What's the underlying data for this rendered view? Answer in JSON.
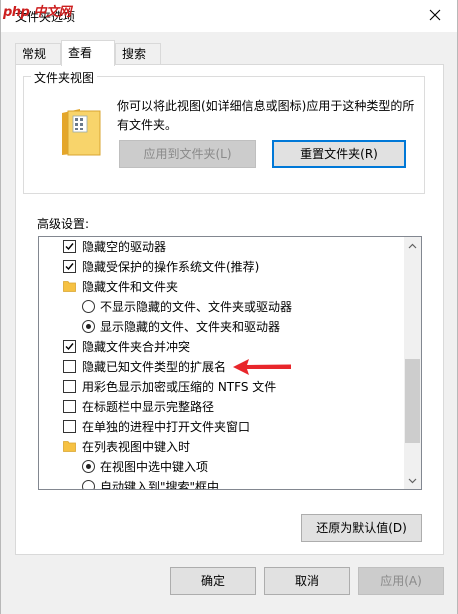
{
  "window": {
    "watermark": "php 中文网",
    "title": "文件夹选项"
  },
  "tabs": [
    {
      "label": "常规"
    },
    {
      "label": "查看"
    },
    {
      "label": "搜索"
    }
  ],
  "folder_views": {
    "title": "文件夹视图",
    "description": "你可以将此视图(如详细信息或图标)应用于这种类型的所有文件夹。",
    "apply_button": "应用到文件夹(L)",
    "reset_button": "重置文件夹(R)"
  },
  "advanced": {
    "label": "高级设置:",
    "items": [
      {
        "type": "checkbox",
        "checked": true,
        "label": "隐藏空的驱动器"
      },
      {
        "type": "checkbox",
        "checked": true,
        "label": "隐藏受保护的操作系统文件(推荐)"
      },
      {
        "type": "folder",
        "label": "隐藏文件和文件夹"
      },
      {
        "type": "radio",
        "checked": false,
        "label": "不显示隐藏的文件、文件夹或驱动器"
      },
      {
        "type": "radio",
        "checked": true,
        "label": "显示隐藏的文件、文件夹和驱动器"
      },
      {
        "type": "checkbox",
        "checked": true,
        "label": "隐藏文件夹合并冲突"
      },
      {
        "type": "checkbox",
        "checked": false,
        "label": "隐藏已知文件类型的扩展名"
      },
      {
        "type": "checkbox",
        "checked": false,
        "label": "用彩色显示加密或压缩的 NTFS 文件"
      },
      {
        "type": "checkbox",
        "checked": false,
        "label": "在标题栏中显示完整路径"
      },
      {
        "type": "checkbox",
        "checked": false,
        "label": "在单独的进程中打开文件夹窗口"
      },
      {
        "type": "folder",
        "label": "在列表视图中键入时"
      },
      {
        "type": "radio",
        "checked": true,
        "label": "在视图中选中键入项"
      },
      {
        "type": "radio",
        "checked": false,
        "label": "自动键入到\"搜索\"框中"
      }
    ],
    "restore_button": "还原为默认值(D)"
  },
  "footer": {
    "ok": "确定",
    "cancel": "取消",
    "apply": "应用(A)"
  },
  "colors": {
    "accent": "#0078d7",
    "annotation_arrow": "#e8262b",
    "folder": "#f6c142"
  }
}
